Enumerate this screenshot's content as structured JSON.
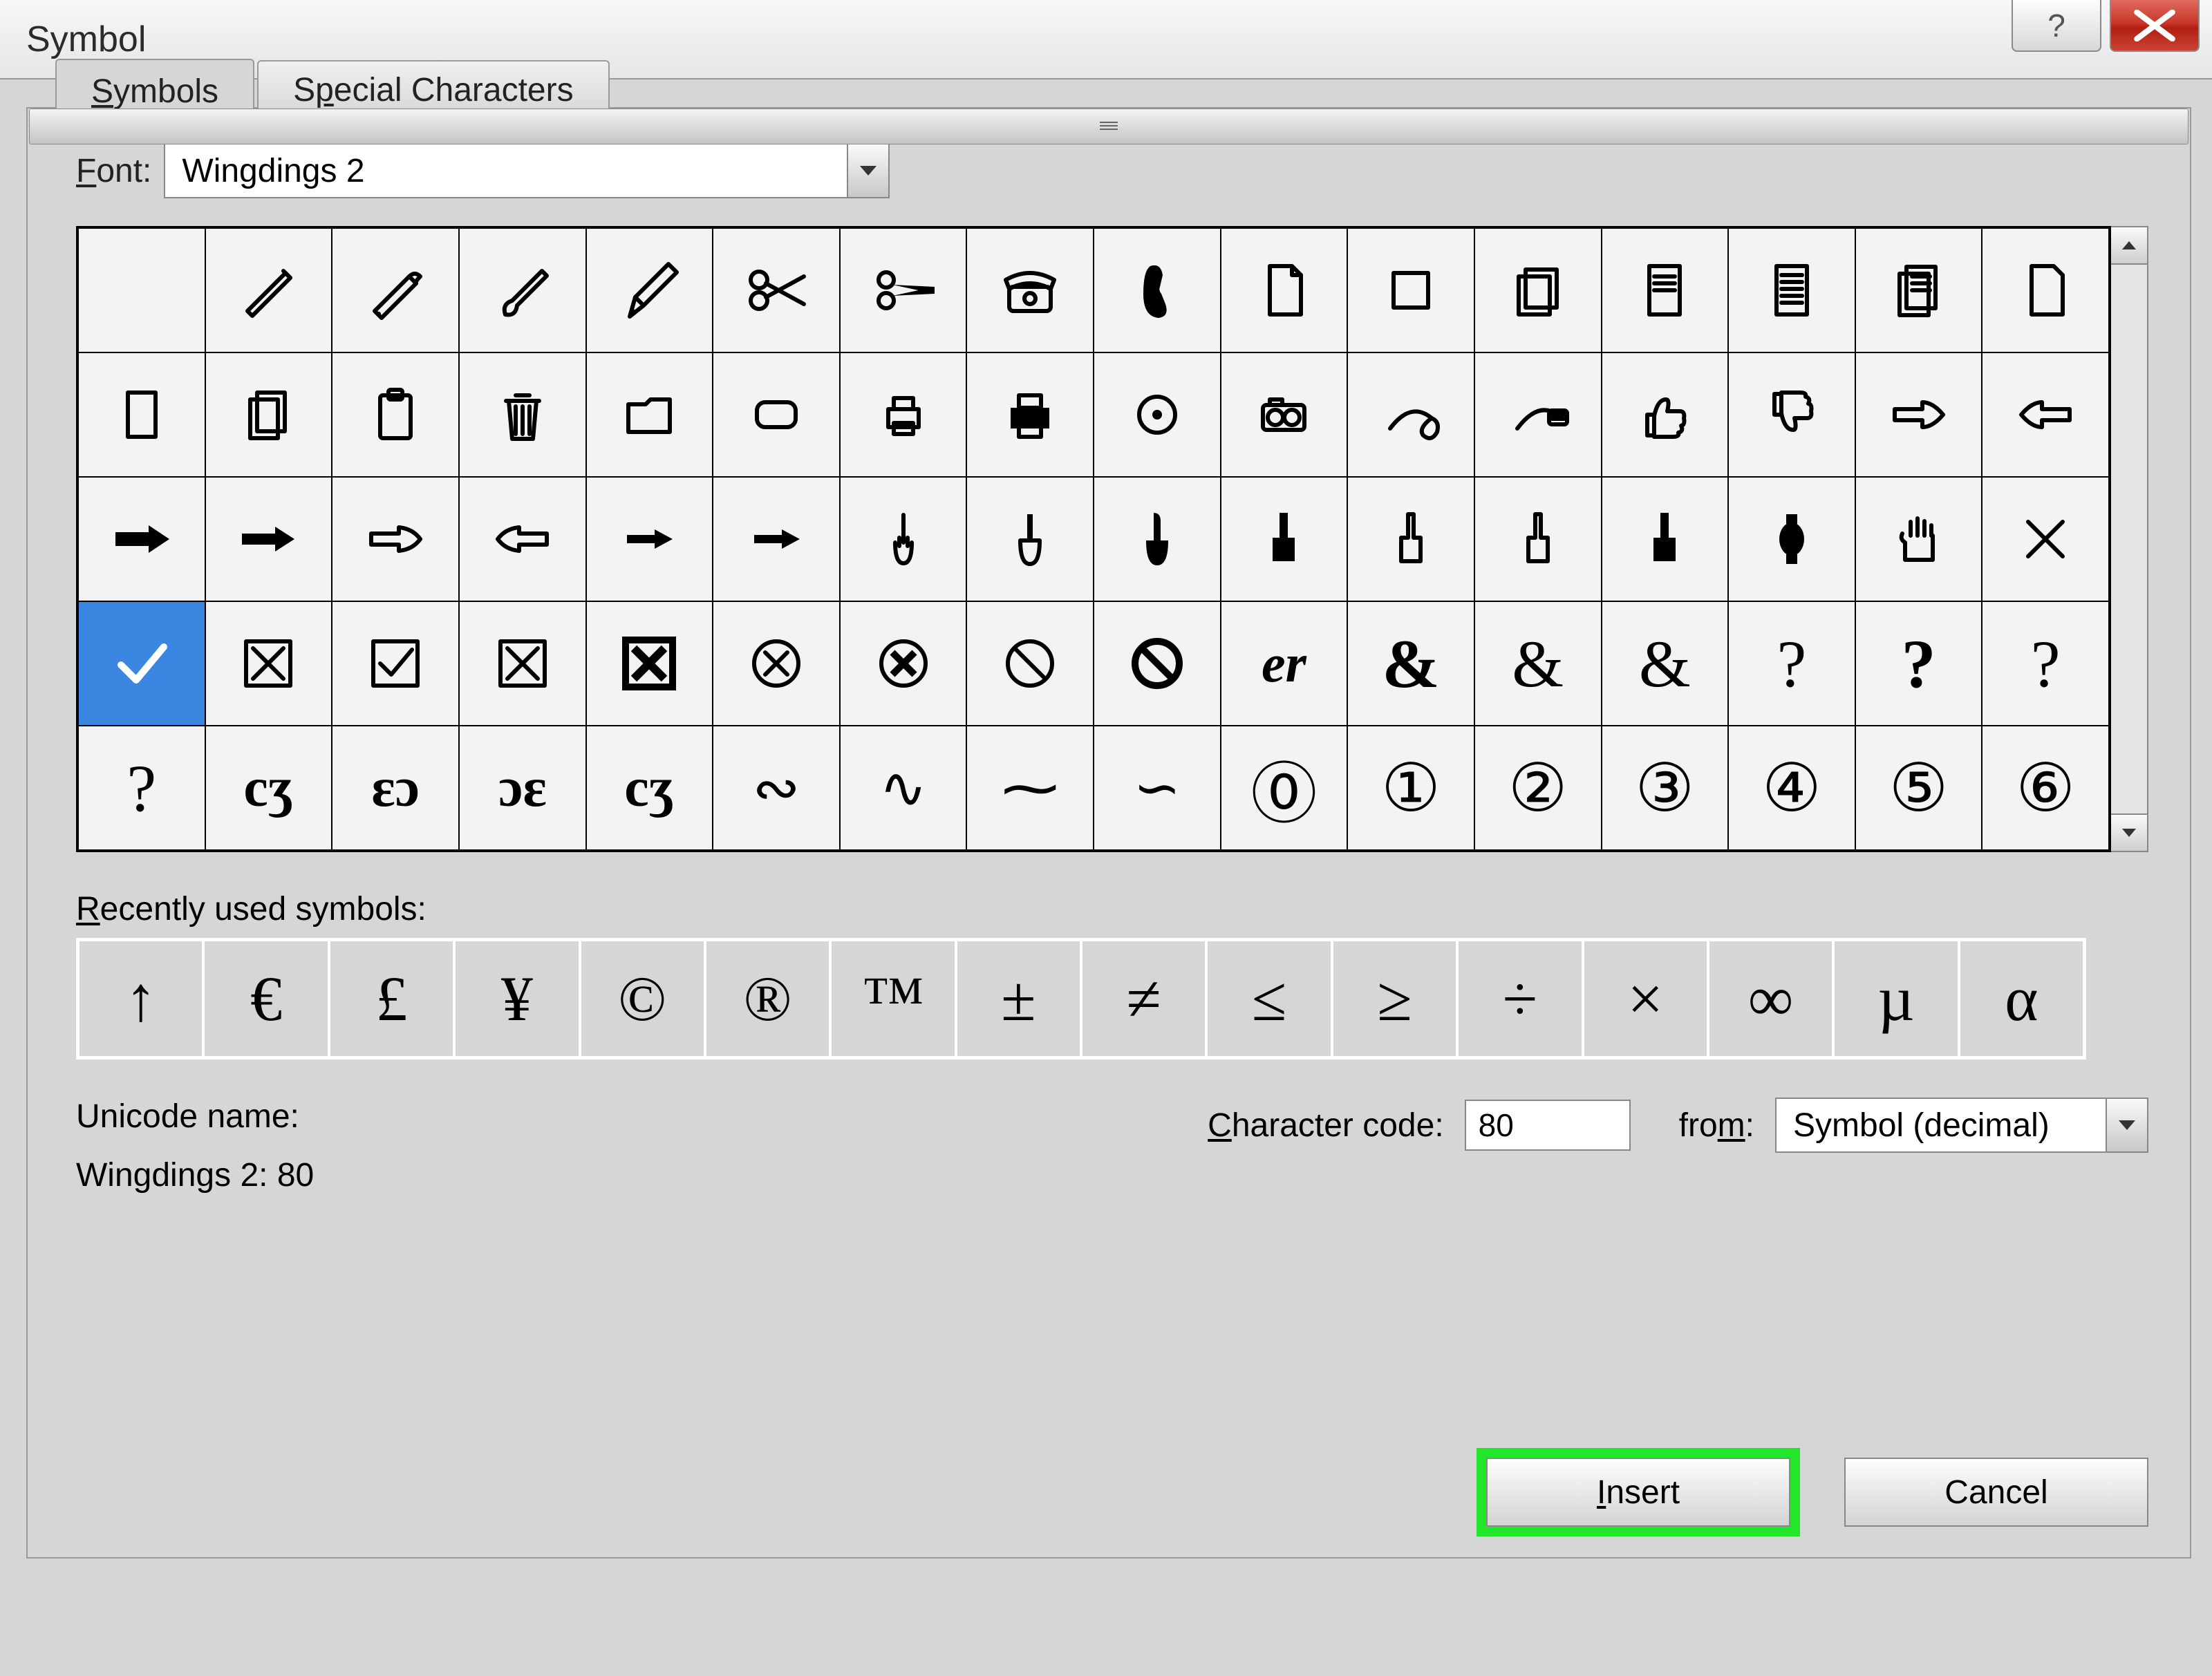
{
  "title": "Symbol",
  "tabs": {
    "symbols": "Symbols",
    "special": "Special Characters"
  },
  "font": {
    "label": "Font:",
    "value": "Wingdings 2"
  },
  "grid": [
    [
      "blank",
      "pen",
      "fountain-pen",
      "brush",
      "pencil",
      "scissors-open",
      "scissors-cut",
      "telephone",
      "handset",
      "page",
      "square",
      "pages",
      "doc",
      "doc-lines",
      "docs",
      "page2"
    ],
    [
      "page-blank",
      "pages2",
      "clipboard",
      "trash",
      "folder",
      "rounded-rect",
      "printer-small",
      "printer",
      "target",
      "camera",
      "mouse",
      "keyboard",
      "thumb-up",
      "thumb-down",
      "point-right-outline",
      "point-left-outline"
    ],
    [
      "point-right-black",
      "point-right-black2",
      "point-right-outline2",
      "point-left-outline2",
      "point-right-small",
      "point-right-small2",
      "finger-up-1",
      "finger-up-2",
      "finger-up-3",
      "finger-up-black",
      "finger-up-outline",
      "finger-up-outline2",
      "finger-up-black2",
      "watch",
      "hand",
      "x-thin"
    ],
    [
      "check",
      "x-box",
      "check-box",
      "x-box2",
      "x-box-bold",
      "x-circle",
      "x-circle2",
      "no-entry",
      "no-entry2",
      "er",
      "ampersand-bold",
      "ampersand-outline",
      "ampersand-italic",
      "question",
      "question-bold",
      "question-serif"
    ],
    [
      "question-heavy",
      "flourish1",
      "flourish2",
      "flourish3",
      "flourish4",
      "flourish5",
      "flourish6",
      "flourish7",
      "flourish8",
      "zero",
      "one",
      "two",
      "three",
      "four",
      "five",
      "six"
    ]
  ],
  "selected_cell": "check",
  "recent_label": "Recently used symbols:",
  "recent": [
    "↑",
    "€",
    "£",
    "¥",
    "©",
    "®",
    "™",
    "±",
    "≠",
    "≤",
    "≥",
    "÷",
    "×",
    "∞",
    "µ",
    "α"
  ],
  "unicode": {
    "label": "Unicode name:",
    "value": "Wingdings 2: 80"
  },
  "charcode": {
    "label": "Character code:",
    "value": "80"
  },
  "from": {
    "label": "from:",
    "value": "Symbol (decimal)"
  },
  "buttons": {
    "insert": "Insert",
    "cancel": "Cancel"
  }
}
